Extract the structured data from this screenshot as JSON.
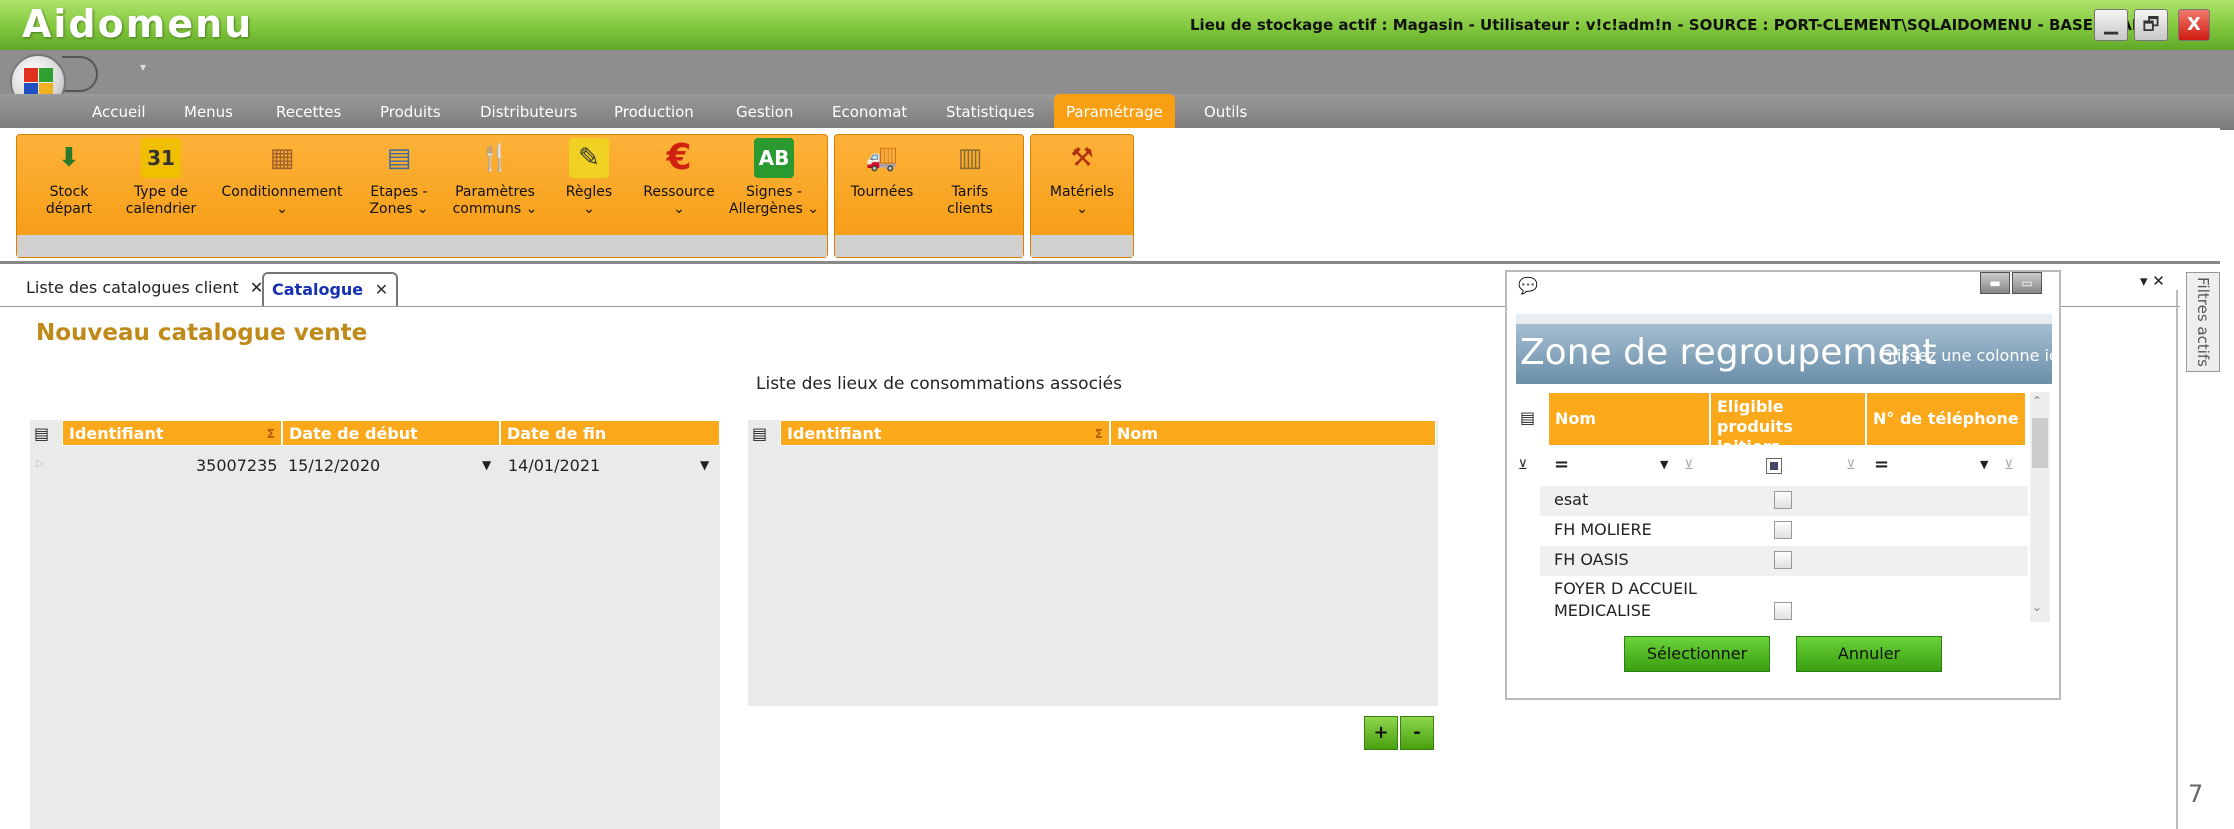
{
  "app": {
    "title": "Aidomenu",
    "info": "Lieu de stockage actif : Magasin - Utilisateur : v!c!adm!n - SOURCE : PORT-CLEMENT\\SQLAIDOMENU - BASE : SARA",
    "min_icon": "▁",
    "max_icon": "🗗",
    "close_icon": "X",
    "qa_arrow": "▾"
  },
  "menu": [
    "Accueil",
    "Menus",
    "Recettes",
    "Produits",
    "Distributeurs",
    "Production",
    "Gestion",
    "Economat",
    "Statistiques",
    "Paramétrage",
    "Outils"
  ],
  "ribbon": {
    "items": [
      {
        "label": "Stock\ndépart",
        "icon": "⬇"
      },
      {
        "label": "Type de\ncalendrier",
        "icon": "31"
      },
      {
        "label": "Conditionnement\n⌄",
        "icon": "▦"
      },
      {
        "label": "Etapes -\nZones ⌄",
        "icon": "▤"
      },
      {
        "label": "Paramètres\ncommuns ⌄",
        "icon": "🍴"
      },
      {
        "label": "Règles\n⌄",
        "icon": "✎"
      },
      {
        "label": "Ressource\n⌄",
        "icon": "€"
      },
      {
        "label": "Signes -\nAllergènes ⌄",
        "icon": "AB"
      },
      {
        "label": "Tournées",
        "icon": "🚚"
      },
      {
        "label": "Tarifs\nclients",
        "icon": "▥"
      },
      {
        "label": "Matériels\n⌄",
        "icon": "⚒"
      }
    ]
  },
  "tabs": {
    "list": "Liste des catalogues client",
    "catalogue": "Catalogue",
    "close": "✕",
    "pin": "▾ ✕"
  },
  "page": {
    "title": "Nouveau catalogue vente",
    "assoc_title": "Liste des lieux de consommations associés"
  },
  "grid1": {
    "headers": [
      "Identifiant",
      "Date de début",
      "Date de fin"
    ],
    "row": {
      "id": "35007235",
      "start": "15/12/2020",
      "end": "14/01/2021"
    }
  },
  "grid2": {
    "headers": [
      "Identifiant",
      "Nom"
    ]
  },
  "buttons": {
    "plus": "+",
    "minus": "-"
  },
  "popup": {
    "group_zone": "Zone de regroupement",
    "group_hint": "Glissez une colonne ic",
    "headers": [
      "Nom",
      "Eligible produits laitiers",
      "N° de téléphone"
    ],
    "filter_eq": "=",
    "rows": [
      {
        "name": "esat",
        "checked": false
      },
      {
        "name": "FH MOLIERE",
        "checked": false
      },
      {
        "name": "FH OASIS",
        "checked": false
      },
      {
        "name": "FOYER  D ACCUEIL MEDICALISE",
        "checked": false
      }
    ],
    "select": "Sélectionner",
    "cancel": "Annuler"
  },
  "side": {
    "filters": "Filtres actifs",
    "page_num": "7"
  },
  "colors": {
    "accent": "#fba81a",
    "title_green": "#7ec43a",
    "page_title": "#c08a18",
    "tab_blue": "#1530b0"
  }
}
